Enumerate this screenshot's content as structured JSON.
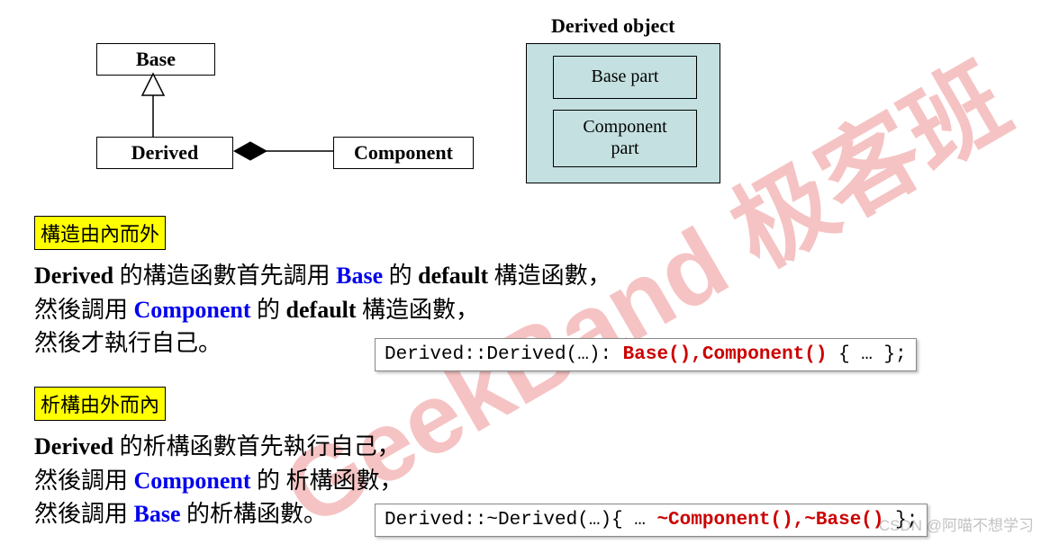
{
  "uml": {
    "base": "Base",
    "derived": "Derived",
    "component": "Component"
  },
  "object_diagram": {
    "title": "Derived object",
    "base_part": "Base part",
    "component_part_l1": "Component",
    "component_part_l2": "part"
  },
  "section1": {
    "heading": "構造由內而外",
    "line1_a": "Derived ",
    "line1_b": "的構造函數首先調用 ",
    "line1_base": "Base",
    "line1_c": " 的 ",
    "line1_default": "default ",
    "line1_d": "構造函數，",
    "line2_a": "然後調用 ",
    "line2_comp": "Component",
    "line2_b": " 的 ",
    "line2_default": "default ",
    "line2_c": "構造函數，",
    "line3": "然後才執行自己。"
  },
  "code1": {
    "pre": "Derived::Derived(…): ",
    "red": "Base(),Component()",
    "post": " { … };"
  },
  "section2": {
    "heading": "析構由外而內",
    "line1_a": "Derived ",
    "line1_b": "的析構函數首先執行自己，",
    "line2_a": "然後調用 ",
    "line2_comp": "Component",
    "line2_b": " 的 析構函數，",
    "line3_a": "然後調用 ",
    "line3_base": "Base",
    "line3_b": " 的析構函數。"
  },
  "code2": {
    "pre": "Derived::~Derived(…){ … ",
    "red": "~Component(),~Base()",
    "post": " };"
  },
  "watermark_geek": "GeekBand 极客班",
  "watermark_csdn": "CSDN @阿喵不想学习"
}
